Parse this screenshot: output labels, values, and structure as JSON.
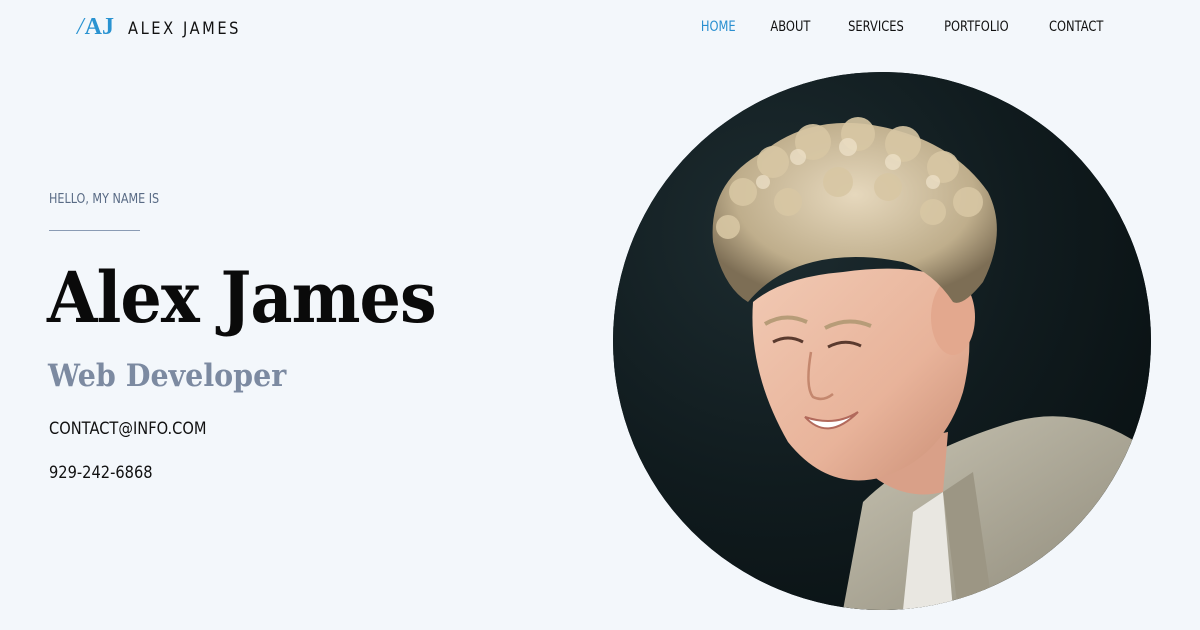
{
  "header": {
    "logo_mark_slash": "/",
    "logo_mark_letters": "AJ",
    "logo_name": "ALEX JAMES",
    "brand_color": "#2a93d1"
  },
  "nav": {
    "items": [
      {
        "label": "HOME",
        "active": true
      },
      {
        "label": "ABOUT",
        "active": false
      },
      {
        "label": "SERVICES",
        "active": false
      },
      {
        "label": "PORTFOLIO",
        "active": false
      },
      {
        "label": "CONTACT",
        "active": false
      }
    ]
  },
  "hero": {
    "greeting": "HELLO, MY NAME IS",
    "name": "Alex James",
    "role": "Web Developer",
    "email": "CONTACT@INFO.COM",
    "phone": "929-242-6868"
  },
  "colors": {
    "background": "#f3f7fb",
    "accent": "#2a8fd0",
    "role_text": "#7c8aa1",
    "greeting_text": "#596b85"
  }
}
